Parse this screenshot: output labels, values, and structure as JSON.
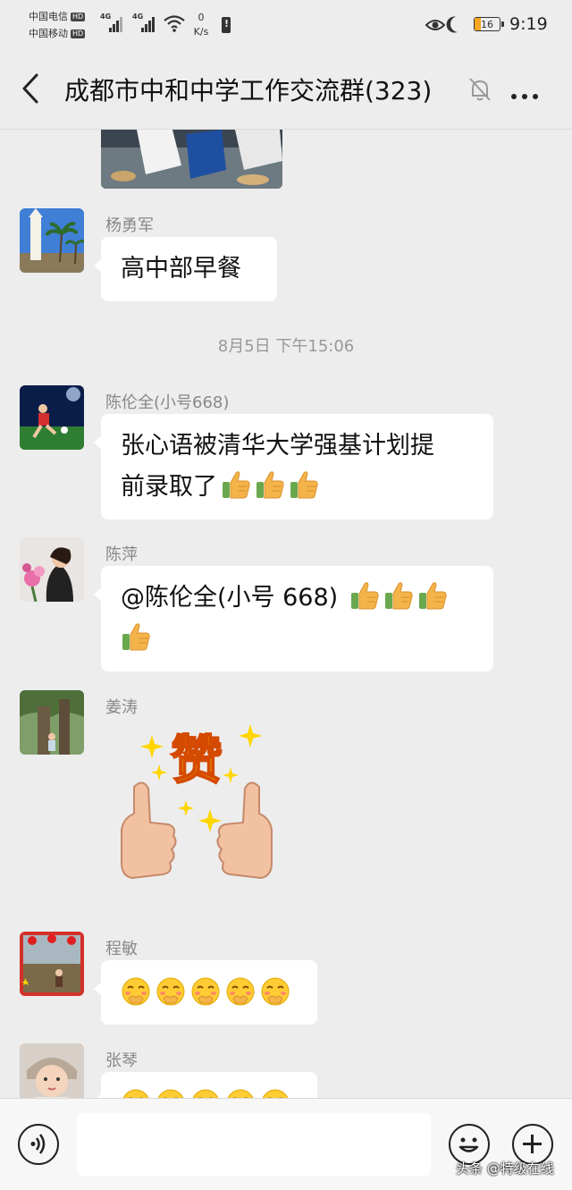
{
  "status_bar": {
    "carrier1": "中国电信",
    "carrier2": "中国移动",
    "hd": "HD",
    "network": "4G",
    "speed_value": "0",
    "speed_unit": "K/s",
    "battery": "16",
    "time": "9:19"
  },
  "header": {
    "title": "成都市中和中学工作交流群(323)",
    "back_icon": "chevron-left-icon",
    "mute_icon": "bell-off-icon",
    "more_icon": "more-dots-icon"
  },
  "messages": [
    {
      "type": "image",
      "desc_icon": "photo-thumbnail"
    },
    {
      "sender": "杨勇军",
      "text": "高中部早餐"
    },
    {
      "type": "timestamp",
      "text": "8月5日 下午15:06"
    },
    {
      "sender": "陈伦全(小号668)",
      "text_line1": "张心语被清华大学强基计划提",
      "text_line2": "前录取了"
    },
    {
      "sender": "陈萍",
      "text_line1": "@陈伦全(小号 668) "
    },
    {
      "sender": "姜涛",
      "sticker_text": "赞"
    },
    {
      "sender": "程敏"
    },
    {
      "sender": "张琴"
    }
  ],
  "input_bar": {
    "voice_icon": "voice-icon",
    "emoji_icon": "emoji-icon",
    "plus_icon": "plus-icon"
  },
  "watermark": "头条 @特级在线",
  "colors": {
    "background": "#ededed",
    "bubble": "#ffffff",
    "name": "#888888",
    "thumb": "#f4b44a"
  }
}
